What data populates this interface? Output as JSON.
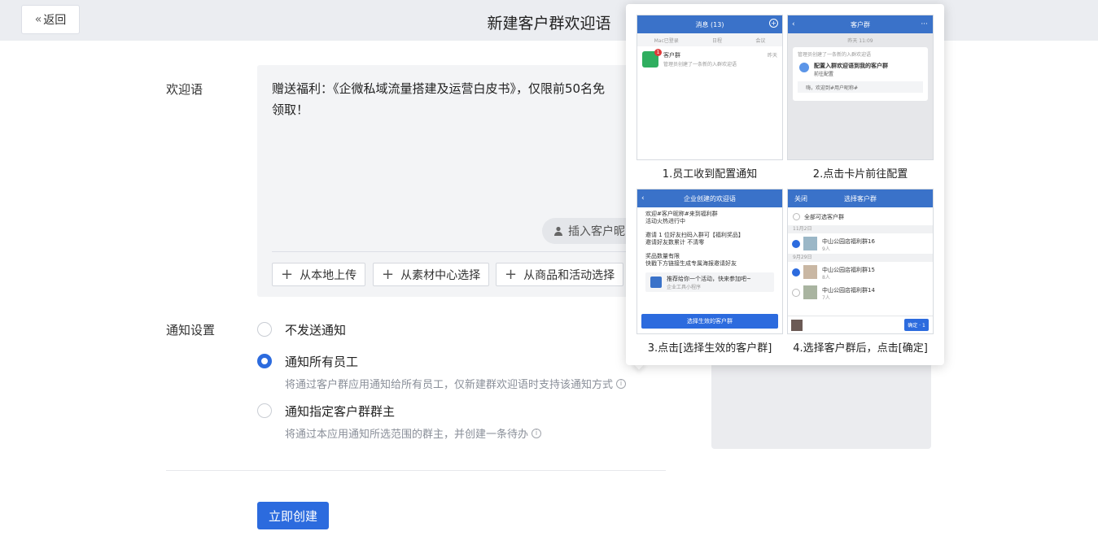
{
  "header": {
    "back_label": "返回",
    "title": "新建客户群欢迎语"
  },
  "form": {
    "welcome_label": "欢迎语",
    "welcome_text_line1": "赠送福利：《企微私域流量搭建及运营白皮书》，仅限前50名免",
    "welcome_text_line2": "领取！",
    "insert_label": "插入客户昵",
    "upload_buttons": [
      "从本地上传",
      "从素材中心选择",
      "从商品和活动选择"
    ],
    "notify_label": "通知设置",
    "options": [
      {
        "label": "不发送通知",
        "desc": "",
        "checked": false
      },
      {
        "label": "通知所有员工",
        "desc": "将通过客户群应用通知给所有员工，仅新建群欢迎语时支持该通知方式",
        "checked": true
      },
      {
        "label": "通知指定客户群群主",
        "desc": "将通过本应用通知所选范围的群主，并创建一条待办",
        "checked": false
      }
    ],
    "submit_label": "立即创建"
  },
  "popover": {
    "captions": [
      "1.员工收到配置通知",
      "2.点击卡片前往配置",
      "3.点击[选择生效的客户群]",
      "4.选择客户群后，点击[确定]"
    ],
    "s1": {
      "head": "消息 (13)",
      "tabs": [
        "Mac已登录",
        "日程",
        "会议"
      ],
      "item_title": "客户群",
      "item_sub": "管理员创建了一条新的入群欢迎语",
      "item_time": "昨天",
      "badge": "1"
    },
    "s2": {
      "head": "客户群",
      "time": "昨天 11:09",
      "notice": "管理员创建了一条新的入群欢迎语",
      "card_title": "配置入群欢迎语到我的客户群",
      "card_sub": "前往配置",
      "greet": "嗨，欢迎到#用户昵称#"
    },
    "s3": {
      "head": "企业创建的欢迎语",
      "l1": "欢迎#客户昵称#来到福利群",
      "l2": "活动火热进行中",
      "l3": "邀请 1 位好友扫码入群可【福利奖品】",
      "l4": "邀请好友数累计 不清零",
      "l5": "奖品数量有限",
      "l6": "快戳下方链接生成专属海报邀请好友",
      "link_title": "推荐给你一个活动，快来参加吧~",
      "link_sub": "企业工具小程序",
      "button": "选择生效的客户群"
    },
    "s4": {
      "close": "关闭",
      "head": "选择客户群",
      "all": "全部可选客户群",
      "date1": "11月2日",
      "date2": "9月29日",
      "groups": [
        {
          "name": "中山公园店福利群16",
          "count": "9人",
          "checked": true
        },
        {
          "name": "中山公园店福利群15",
          "count": "8人",
          "checked": true
        },
        {
          "name": "中山公园店福利群14",
          "count": "7人",
          "checked": false
        }
      ],
      "confirm": "确定 · 1"
    }
  }
}
